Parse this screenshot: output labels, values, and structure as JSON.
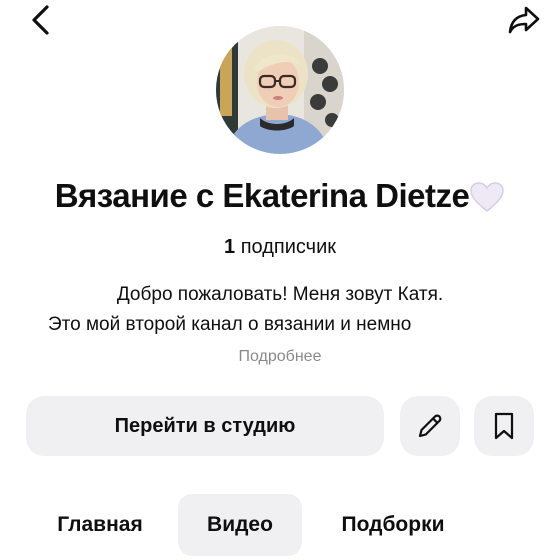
{
  "header": {
    "back_icon": "back-chevron-icon",
    "share_icon": "share-icon"
  },
  "channel": {
    "name": "Вязание с Ekaterina Dietze",
    "name_emoji_icon": "white-heart-icon",
    "subscriber_count": "1",
    "subscriber_label": "подписчик",
    "description_line1": "Добро пожаловать! Меня зовут Катя.",
    "description_line2": "Это мой второй канал о вязании и немно",
    "more_label": "Подробнее"
  },
  "actions": {
    "studio_label": "Перейти в студию",
    "edit_icon": "pencil-icon",
    "save_icon": "bookmark-icon"
  },
  "tabs": [
    {
      "label": "Главная",
      "selected": false
    },
    {
      "label": "Видео",
      "selected": true
    },
    {
      "label": "Подборки",
      "selected": false
    }
  ],
  "colors": {
    "button_bg": "#f0f0f2",
    "muted_text": "#8a8a8a",
    "text": "#0f0f0f"
  }
}
